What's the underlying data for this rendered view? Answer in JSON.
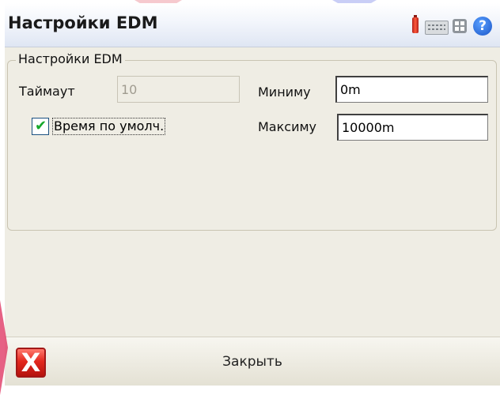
{
  "window": {
    "title": "Настройки EDM",
    "status_icons": [
      "battery-icon",
      "keyboard-icon",
      "grid-icon",
      "help-icon"
    ],
    "help_glyph": "?"
  },
  "group": {
    "legend": "Настройки EDM",
    "timeout": {
      "label": "Таймаут",
      "value": "10",
      "enabled": false
    },
    "default_time": {
      "label": "Время по умолч.",
      "checked": true
    },
    "minimum": {
      "label": "Миниму",
      "value": "0m"
    },
    "maximum": {
      "label": "Максиму",
      "value": "10000m"
    }
  },
  "footer": {
    "close_label": "Закрыть",
    "close_glyph": "X"
  },
  "colors": {
    "window_bg": "#efede4",
    "check": "#17a82a",
    "close_red": "#e3281e"
  }
}
